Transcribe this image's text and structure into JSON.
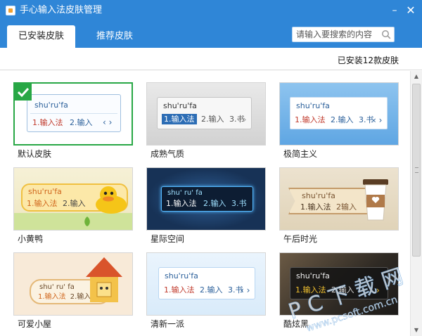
{
  "window": {
    "title": "手心输入法皮肤管理",
    "minimize_label": "–",
    "close_label": "✕"
  },
  "tabs": [
    {
      "label": "已安装皮肤",
      "active": true
    },
    {
      "label": "推荐皮肤",
      "active": false
    }
  ],
  "search": {
    "placeholder": "请输入要搜索的内容",
    "value": ""
  },
  "status": {
    "installed_count": "已安装12款皮肤"
  },
  "colors": {
    "chrome_blue": "#2f86d7",
    "selected_green": "#28a745"
  },
  "skins": [
    {
      "name": "默认皮肤",
      "pinyin": "shu'ru'fa",
      "cand1": "1.输入法",
      "cand2": "2.输入",
      "selected": true
    },
    {
      "name": "成熟气质",
      "pinyin": "shu'ru'fa",
      "cand1": "1.输入法",
      "cand2": "2.输入",
      "cand3": "3.书"
    },
    {
      "name": "极简主义",
      "pinyin": "shu'ru'fa",
      "cand1": "1.输入法",
      "cand2": "2.输入",
      "cand3": "3.书"
    },
    {
      "name": "小黄鸭",
      "pinyin": "shu'ru'fa",
      "cand1": "1.输入法",
      "cand2": "2.输入"
    },
    {
      "name": "星际空间",
      "pinyin": "shu' ru' fa",
      "cand1": "1.输入法",
      "cand2": "2.输入",
      "cand3": "3.书"
    },
    {
      "name": "午后时光",
      "pinyin": "shu'ru'fa",
      "cand1": "1.输入法",
      "cand2": "2输入"
    },
    {
      "name": "可爱小屋",
      "pinyin": "shu' ru' fa",
      "cand1": "1.输入法",
      "cand2": "2.输入"
    },
    {
      "name": "清新一派",
      "pinyin": "shu'ru'fa",
      "cand1": "1.输入法",
      "cand2": "2.输入",
      "cand3": "3.书"
    },
    {
      "name": "酷炫黑",
      "pinyin": "shu'ru'fa",
      "cand1": "1.输入法",
      "cand2": "2.输入"
    }
  ],
  "watermark": {
    "line1": "PC下载网",
    "line2": "www.pcsoft.com.cn"
  }
}
